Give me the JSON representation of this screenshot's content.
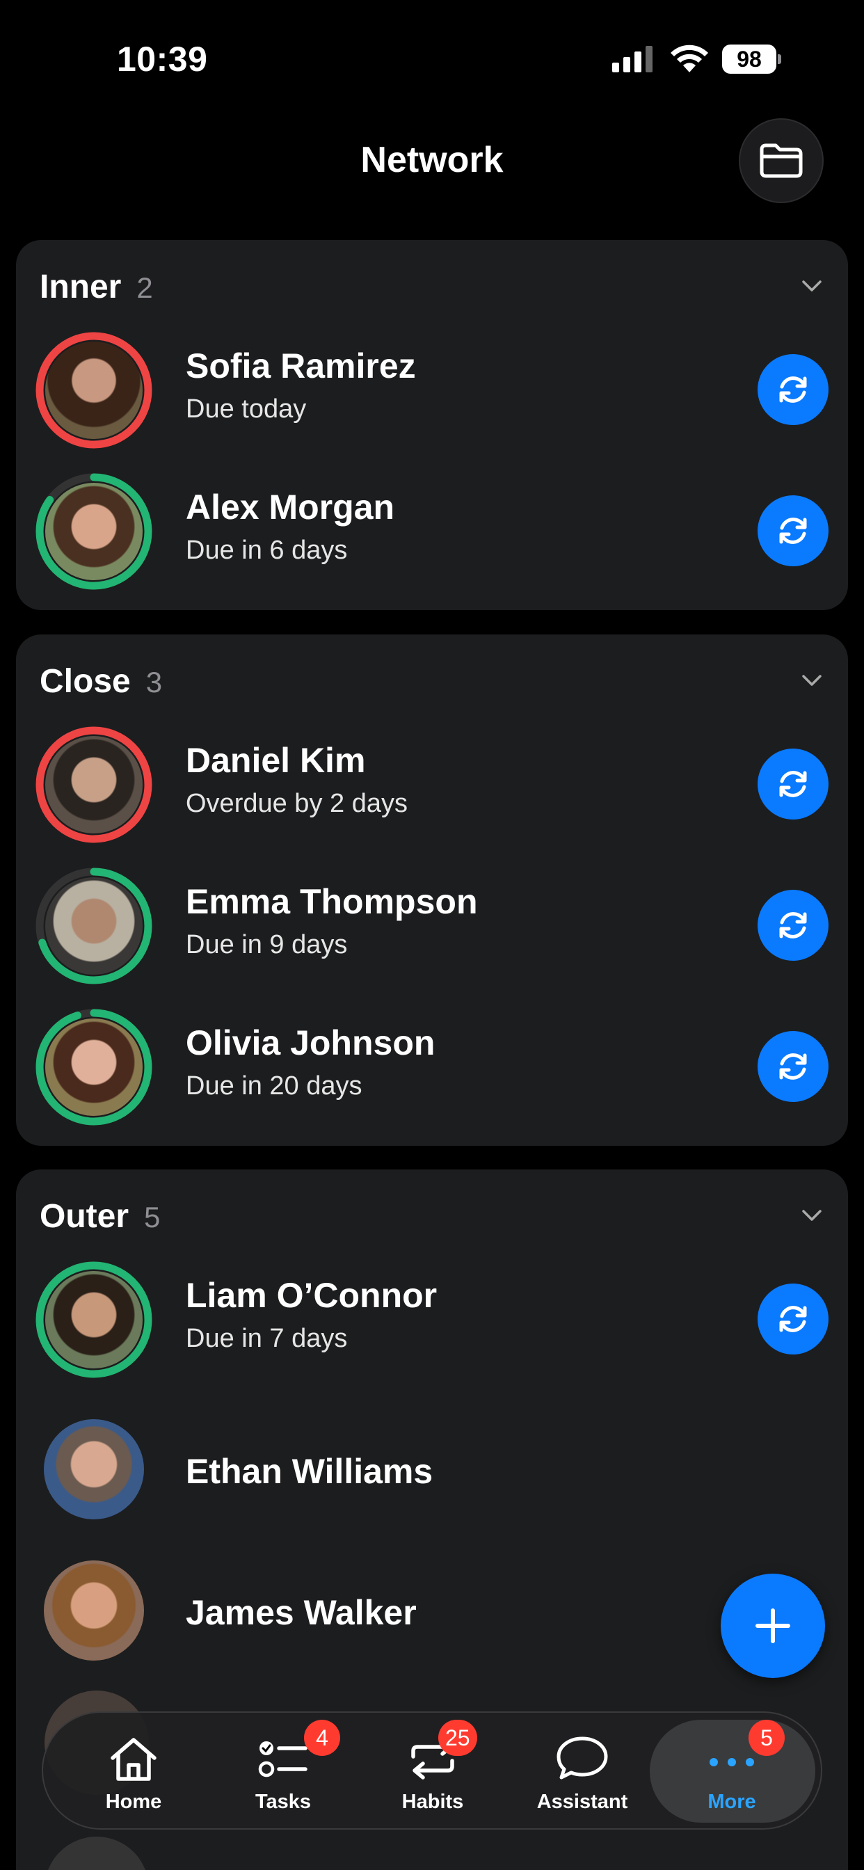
{
  "status_bar": {
    "time": "10:39",
    "battery": "98"
  },
  "header": {
    "title": "Network",
    "folder_icon": "folder-icon"
  },
  "colors": {
    "overdue_ring": "#ef4444",
    "ok_ring": "#22b573",
    "accent": "#0a7aff",
    "badge": "#ff3b30"
  },
  "groups": [
    {
      "title": "Inner",
      "count": "2",
      "contacts": [
        {
          "name": "Sofia Ramirez",
          "status": "Due today",
          "ring": "red",
          "progress": 1.0
        },
        {
          "name": "Alex Morgan",
          "status": "Due in 6 days",
          "ring": "green",
          "progress": 0.85
        }
      ]
    },
    {
      "title": "Close",
      "count": "3",
      "contacts": [
        {
          "name": "Daniel Kim",
          "status": "Overdue by 2 days",
          "ring": "red",
          "progress": 1.0
        },
        {
          "name": "Emma Thompson",
          "status": "Due in 9 days",
          "ring": "green",
          "progress": 0.7
        },
        {
          "name": "Olivia Johnson",
          "status": "Due in 20 days",
          "ring": "green",
          "progress": 0.95
        }
      ]
    },
    {
      "title": "Outer",
      "count": "5",
      "contacts": [
        {
          "name": "Liam O’Connor",
          "status": "Due in 7 days",
          "ring": "green",
          "progress": 1.0
        },
        {
          "name": "Ethan Williams"
        },
        {
          "name": "James Walker"
        }
      ]
    }
  ],
  "tabs": [
    {
      "label": "Home",
      "icon": "home-icon"
    },
    {
      "label": "Tasks",
      "icon": "tasks-icon",
      "badge": "4"
    },
    {
      "label": "Habits",
      "icon": "habits-icon",
      "badge": "25"
    },
    {
      "label": "Assistant",
      "icon": "chat-icon"
    },
    {
      "label": "More",
      "icon": "more-icon",
      "badge": "5",
      "active": true
    }
  ]
}
